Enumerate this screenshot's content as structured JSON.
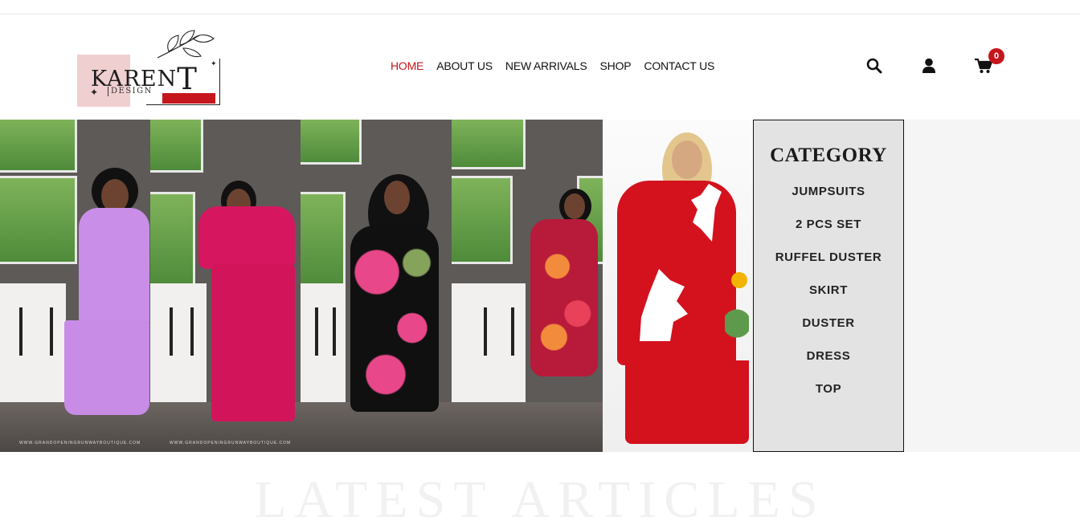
{
  "brand": {
    "name_prefix": "KAREN",
    "name_suffix": "T",
    "tagline": "DESIGN"
  },
  "nav": {
    "items": [
      "HOME",
      "ABOUT US",
      "NEW ARRIVALS",
      "SHOP",
      "CONTACT US"
    ],
    "active": "HOME"
  },
  "header_icons": {
    "search": "search-icon",
    "account": "user-icon",
    "cart": "cart-icon",
    "cart_count": "0"
  },
  "hero": {
    "watermark_1": "WWW.GRANDOPENINGRUNWAYBOUTIQUE.COM",
    "watermark_2": "WWW.GRANDOPENINGRUNWAYBOUTIQUE.COM"
  },
  "category": {
    "title": "CATEGORY",
    "items": [
      "JUMPSUITS",
      "2 PCS SET",
      "RUFFEL DUSTER",
      "SKIRT",
      "DUSTER",
      "DRESS",
      "TOP"
    ]
  },
  "section": {
    "latest_title": "LATEST ARTICLES"
  },
  "colors": {
    "accent": "#c4161c",
    "category_bg": "#e3e3e3"
  }
}
